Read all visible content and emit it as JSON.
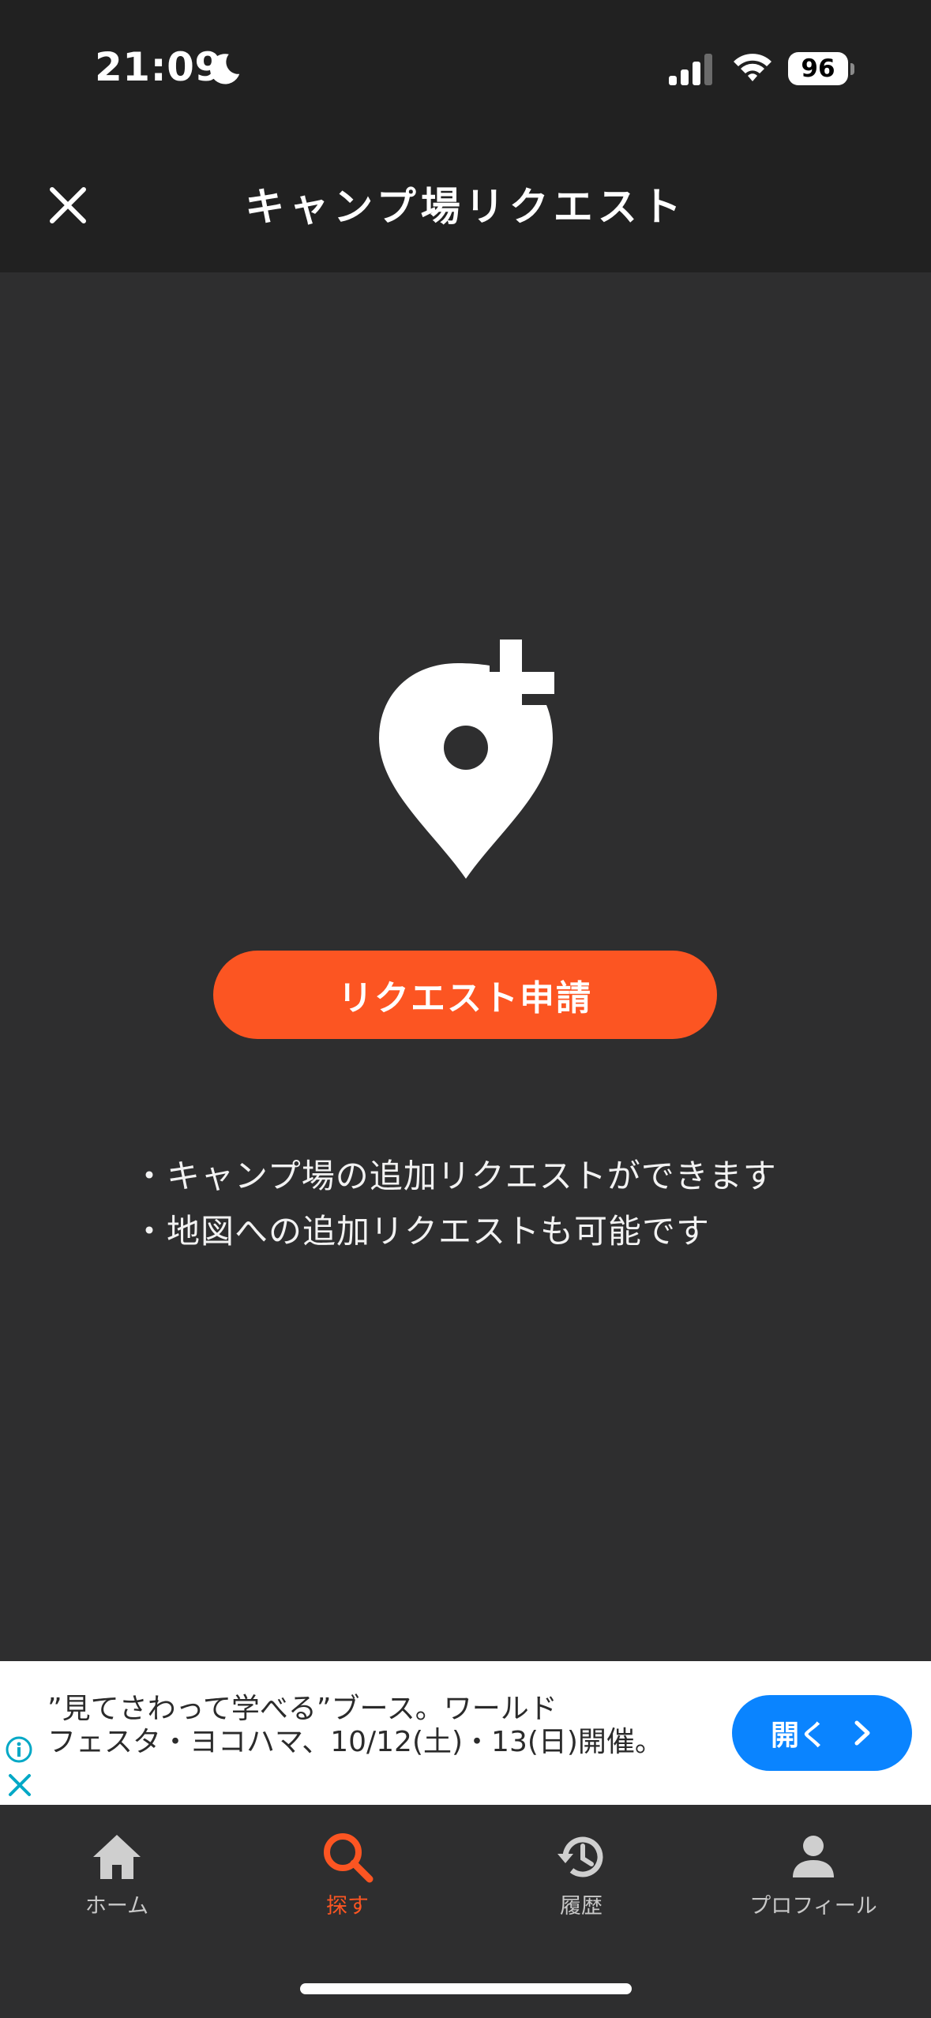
{
  "status_bar": {
    "time": "21:09",
    "battery": "96"
  },
  "header": {
    "title": "キャンプ場リクエスト"
  },
  "main": {
    "request_button_label": "リクエスト申請",
    "info_lines": [
      "・キャンプ場の追加リクエストができます",
      "・地図への追加リクエストも可能です"
    ]
  },
  "ad": {
    "line1": "”見てさわって学べる”ブース。ワールド",
    "line2": "フェスタ・ヨコハマ、10/12(土)・13(日)開催。",
    "open_label": "開く"
  },
  "tabs": [
    {
      "label": "ホーム",
      "icon": "home-icon",
      "active": false
    },
    {
      "label": "探す",
      "icon": "search-icon",
      "active": true
    },
    {
      "label": "履歴",
      "icon": "history-icon",
      "active": false
    },
    {
      "label": "プロフィール",
      "icon": "profile-icon",
      "active": false
    }
  ],
  "colors": {
    "accent": "#fc5522",
    "header_bg": "#212121",
    "body_bg": "#2e2e2f",
    "ad_button": "#0a84ff"
  }
}
